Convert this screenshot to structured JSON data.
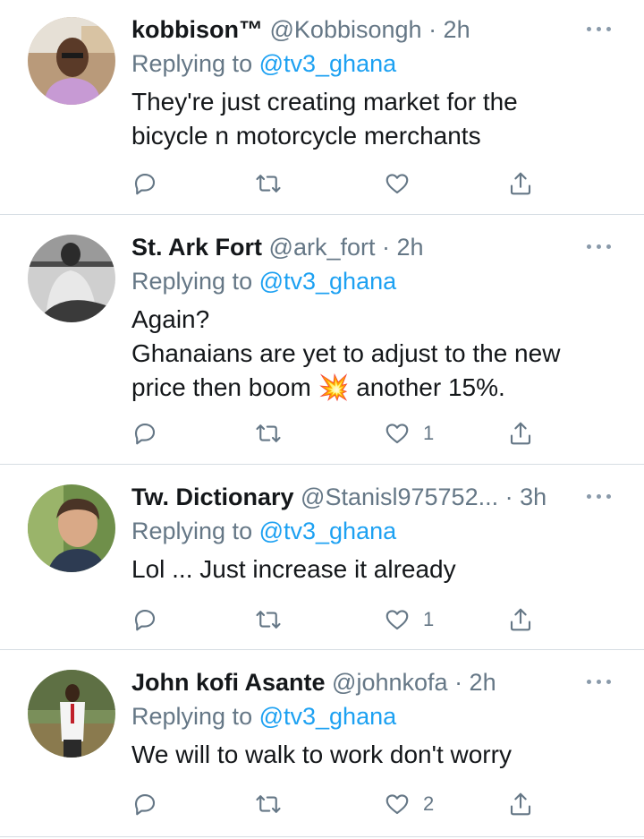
{
  "tweets": [
    {
      "name": "kobbison™",
      "handle": "@Kobbisongh",
      "time": "· 2h",
      "replying_prefix": "Replying to ",
      "replying_to": "@tv3_ghana",
      "lines": [
        "They're just creating market for the",
        "bicycle n motorcycle merchants"
      ],
      "likes": ""
    },
    {
      "name": "St. Ark Fort",
      "handle": "@ark_fort",
      "time": "· 2h",
      "replying_prefix": "Replying to ",
      "replying_to": "@tv3_ghana",
      "lines": [
        "Again?",
        "Ghanaians are yet to adjust to the new",
        "price then boom 💥 another 15%."
      ],
      "likes": "1"
    },
    {
      "name": "Tw. Dictionary",
      "handle": "@Stanisl975752...",
      "time": "· 3h",
      "replying_prefix": "Replying to ",
      "replying_to": "@tv3_ghana",
      "lines": [
        "Lol ... Just increase it already"
      ],
      "likes": "1"
    },
    {
      "name": "John kofi Asante",
      "handle": "@johnkofa",
      "time": "· 2h",
      "replying_prefix": "Replying to ",
      "replying_to": "@tv3_ghana",
      "lines": [
        "We will to walk to work don't worry"
      ],
      "likes": "2"
    }
  ],
  "icons": {
    "reply": "reply-icon",
    "retweet": "retweet-icon",
    "like": "heart-icon",
    "share": "share-icon",
    "more": "more-icon"
  },
  "colors": {
    "link": "#1da1f2",
    "secondary_text": "#657786",
    "divider": "#d6dde3"
  }
}
